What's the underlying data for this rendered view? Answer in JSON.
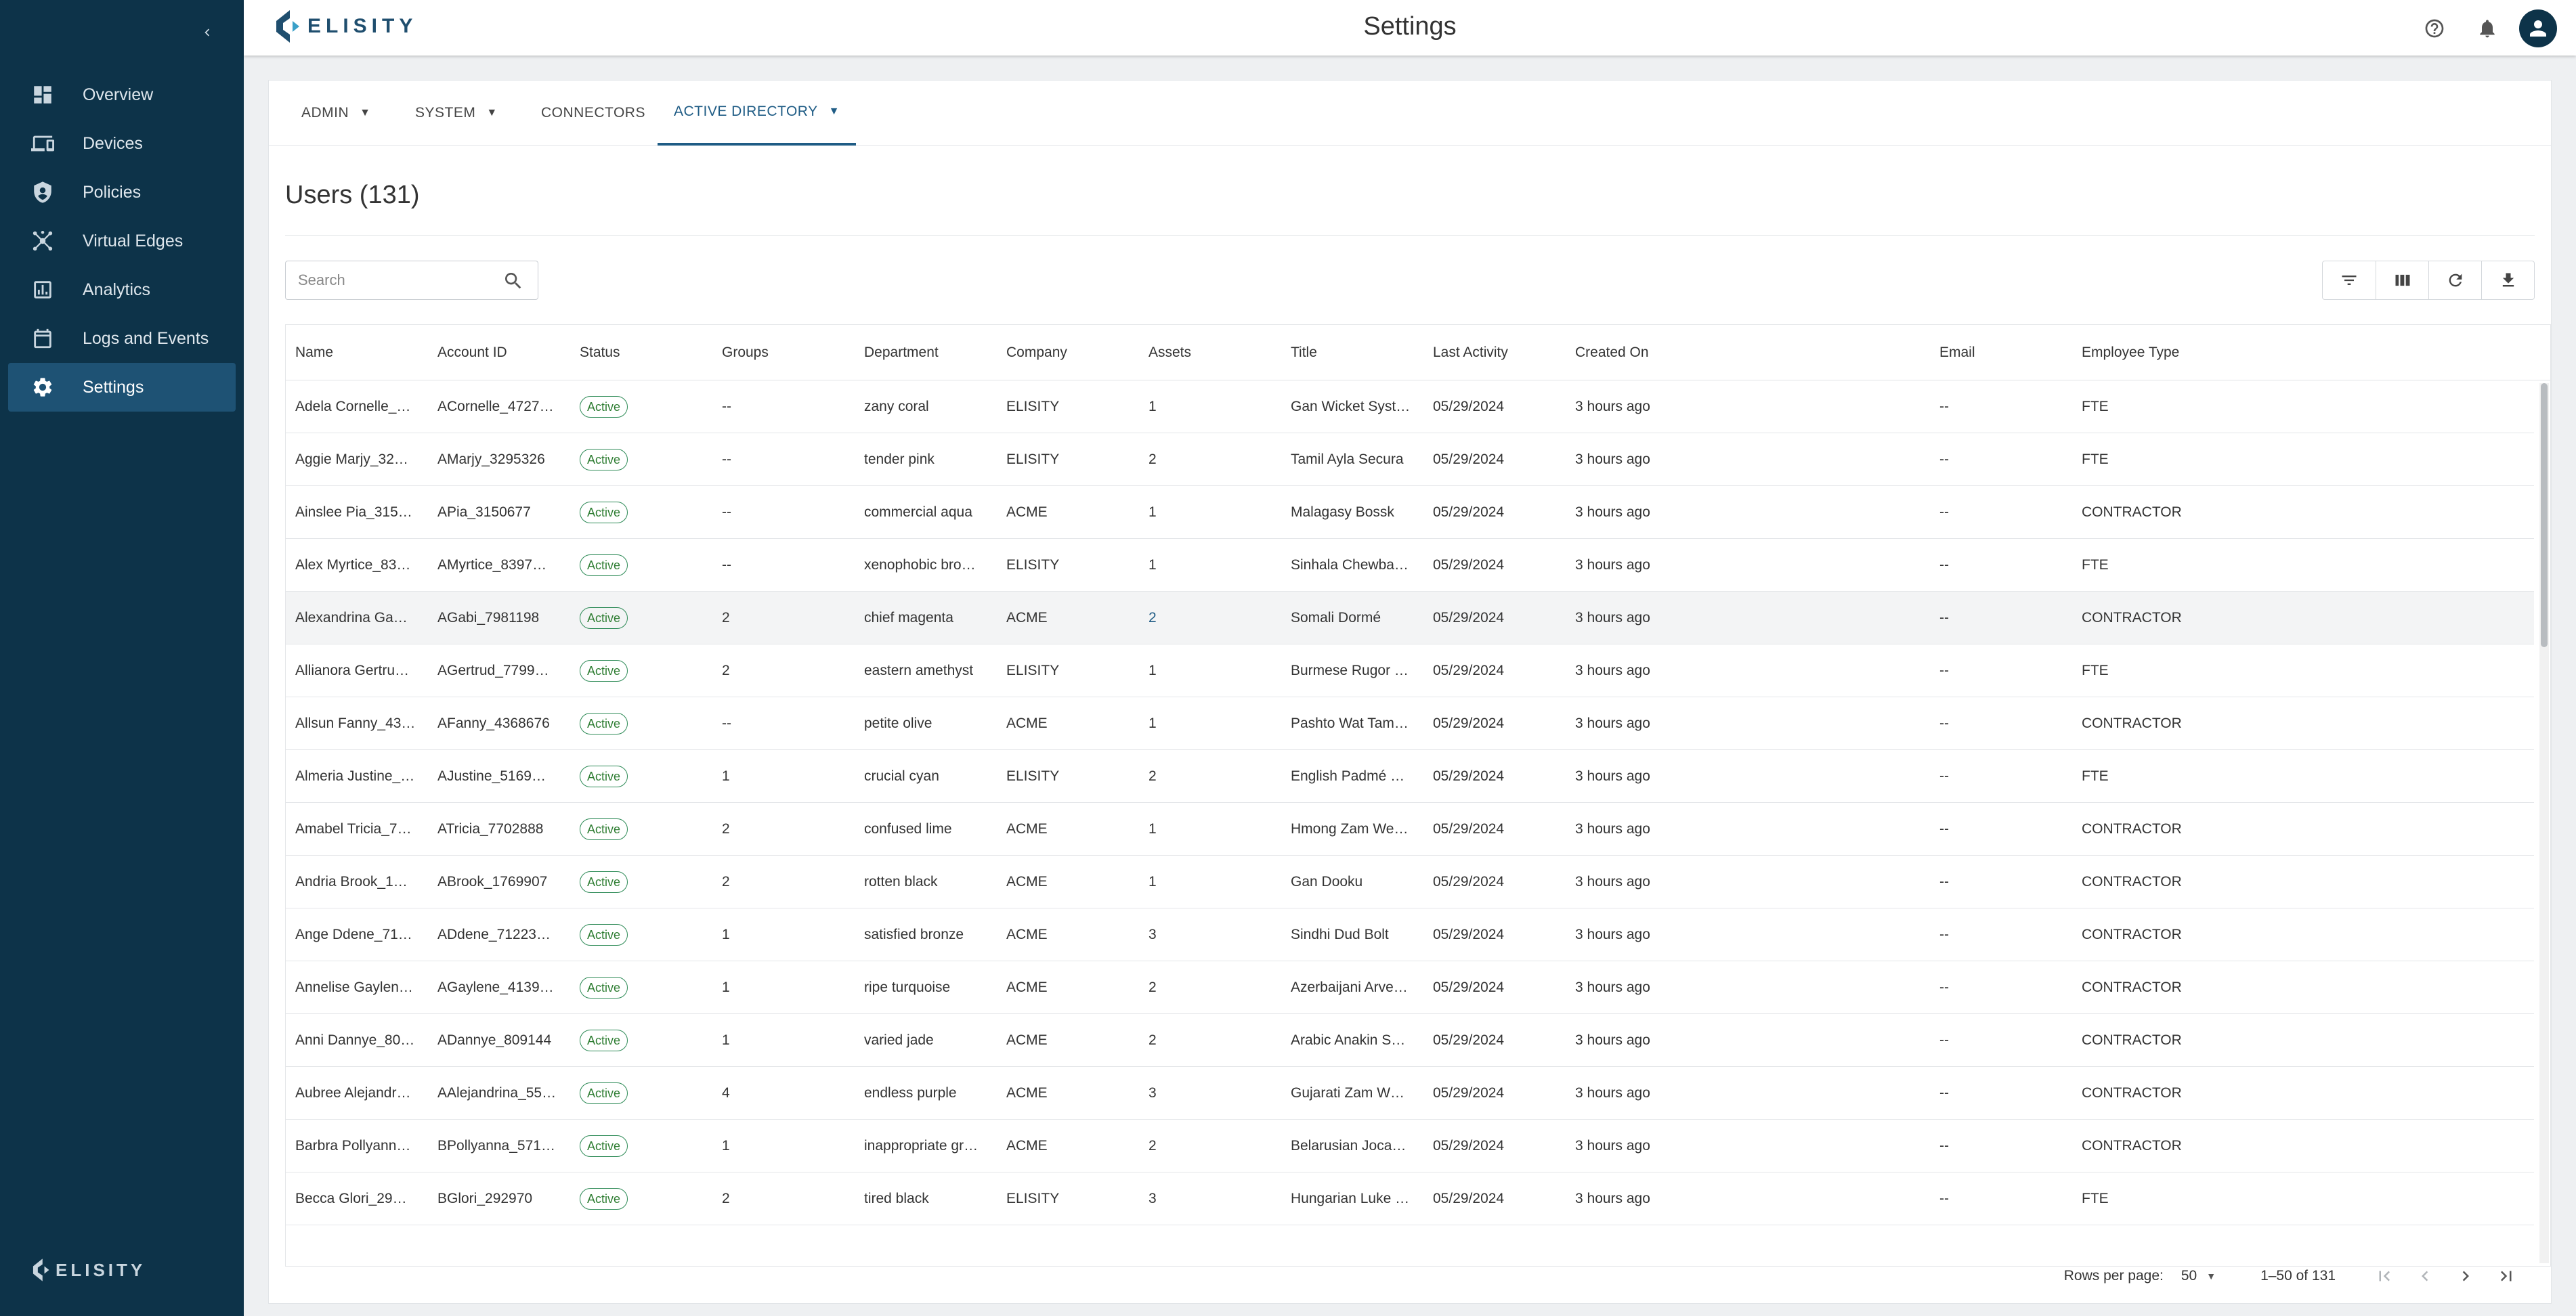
{
  "app": {
    "logo_text": "ELISITY",
    "page_title": "Settings"
  },
  "sidebar": {
    "items": [
      {
        "label": "Overview",
        "icon": "dashboard-icon"
      },
      {
        "label": "Devices",
        "icon": "devices-icon"
      },
      {
        "label": "Policies",
        "icon": "policy-shield-icon"
      },
      {
        "label": "Virtual Edges",
        "icon": "network-hub-icon"
      },
      {
        "label": "Analytics",
        "icon": "analytics-chart-icon"
      },
      {
        "label": "Logs and Events",
        "icon": "calendar-log-icon"
      },
      {
        "label": "Settings",
        "icon": "gear-icon",
        "active": true
      }
    ],
    "footer_logo_text": "ELISITY"
  },
  "topbar": {
    "icons": [
      "help-icon",
      "bell-icon",
      "account-icon"
    ]
  },
  "tabs": [
    {
      "label": "ADMIN",
      "dropdown": true
    },
    {
      "label": "SYSTEM",
      "dropdown": true
    },
    {
      "label": "CONNECTORS",
      "dropdown": false
    },
    {
      "label": "ACTIVE DIRECTORY",
      "dropdown": true,
      "active": true
    }
  ],
  "users": {
    "title": "Users (131)",
    "search_placeholder": "Search",
    "toolbar": [
      "filter-icon",
      "columns-icon",
      "refresh-icon",
      "download-icon"
    ],
    "columns": [
      "Name",
      "Account ID",
      "Status",
      "Groups",
      "Department",
      "Company",
      "Assets",
      "Title",
      "Last Activity",
      "Created On",
      "Email",
      "Employee Type"
    ],
    "rows": [
      [
        "Adela Cornelle_…",
        "ACornelle_4727…",
        "Active",
        "--",
        "zany coral",
        "ELISITY",
        "1",
        "Gan Wicket Syst…",
        "05/29/2024",
        "3 hours ago",
        "--",
        "FTE"
      ],
      [
        "Aggie Marjy_32…",
        "AMarjy_3295326",
        "Active",
        "--",
        "tender pink",
        "ELISITY",
        "2",
        "Tamil Ayla Secura",
        "05/29/2024",
        "3 hours ago",
        "--",
        "FTE"
      ],
      [
        "Ainslee Pia_315…",
        "APia_3150677",
        "Active",
        "--",
        "commercial aqua",
        "ACME",
        "1",
        "Malagasy Bossk",
        "05/29/2024",
        "3 hours ago",
        "--",
        "CONTRACTOR"
      ],
      [
        "Alex Myrtice_83…",
        "AMyrtice_8397…",
        "Active",
        "--",
        "xenophobic bro…",
        "ELISITY",
        "1",
        "Sinhala Chewba…",
        "05/29/2024",
        "3 hours ago",
        "--",
        "FTE"
      ],
      [
        "Alexandrina Ga…",
        "AGabi_7981198",
        "Active",
        "2",
        "chief magenta",
        "ACME",
        "2",
        "Somali Dormé",
        "05/29/2024",
        "3 hours ago",
        "--",
        "CONTRACTOR"
      ],
      [
        "Allianora Gertru…",
        "AGertrud_7799…",
        "Active",
        "2",
        "eastern amethyst",
        "ELISITY",
        "1",
        "Burmese Rugor …",
        "05/29/2024",
        "3 hours ago",
        "--",
        "FTE"
      ],
      [
        "Allsun Fanny_43…",
        "AFanny_4368676",
        "Active",
        "--",
        "petite olive",
        "ACME",
        "1",
        "Pashto Wat Tam…",
        "05/29/2024",
        "3 hours ago",
        "--",
        "CONTRACTOR"
      ],
      [
        "Almeria Justine_…",
        "AJustine_5169…",
        "Active",
        "1",
        "crucial cyan",
        "ELISITY",
        "2",
        "English Padmé …",
        "05/29/2024",
        "3 hours ago",
        "--",
        "FTE"
      ],
      [
        "Amabel Tricia_7…",
        "ATricia_7702888",
        "Active",
        "2",
        "confused lime",
        "ACME",
        "1",
        "Hmong Zam We…",
        "05/29/2024",
        "3 hours ago",
        "--",
        "CONTRACTOR"
      ],
      [
        "Andria Brook_1…",
        "ABrook_1769907",
        "Active",
        "2",
        "rotten black",
        "ACME",
        "1",
        "Gan Dooku",
        "05/29/2024",
        "3 hours ago",
        "--",
        "CONTRACTOR"
      ],
      [
        "Ange Ddene_71…",
        "ADdene_71223…",
        "Active",
        "1",
        "satisfied bronze",
        "ACME",
        "3",
        "Sindhi Dud Bolt",
        "05/29/2024",
        "3 hours ago",
        "--",
        "CONTRACTOR"
      ],
      [
        "Annelise Gaylen…",
        "AGaylene_4139…",
        "Active",
        "1",
        "ripe turquoise",
        "ACME",
        "2",
        "Azerbaijani Arve…",
        "05/29/2024",
        "3 hours ago",
        "--",
        "CONTRACTOR"
      ],
      [
        "Anni Dannye_80…",
        "ADannye_809144",
        "Active",
        "1",
        "varied jade",
        "ACME",
        "2",
        "Arabic Anakin S…",
        "05/29/2024",
        "3 hours ago",
        "--",
        "CONTRACTOR"
      ],
      [
        "Aubree Alejandr…",
        "AAlejandrina_55…",
        "Active",
        "4",
        "endless purple",
        "ACME",
        "3",
        "Gujarati Zam W…",
        "05/29/2024",
        "3 hours ago",
        "--",
        "CONTRACTOR"
      ],
      [
        "Barbra Pollyann…",
        "BPollyanna_571…",
        "Active",
        "1",
        "inappropriate gr…",
        "ACME",
        "2",
        "Belarusian Joca…",
        "05/29/2024",
        "3 hours ago",
        "--",
        "CONTRACTOR"
      ],
      [
        "Becca Glori_29…",
        "BGlori_292970",
        "Active",
        "2",
        "tired black",
        "ELISITY",
        "3",
        "Hungarian Luke …",
        "05/29/2024",
        "3 hours ago",
        "--",
        "FTE"
      ]
    ],
    "highlighted_row": 4,
    "pagination": {
      "rows_per_page_label": "Rows per page:",
      "rows_per_page": "50",
      "range": "1–50 of 131"
    }
  },
  "colors": {
    "sidebar_bg": "#0d3349",
    "sidebar_active": "#1e5274",
    "accent": "#1f5c85",
    "status_active": "#2e7d32"
  }
}
